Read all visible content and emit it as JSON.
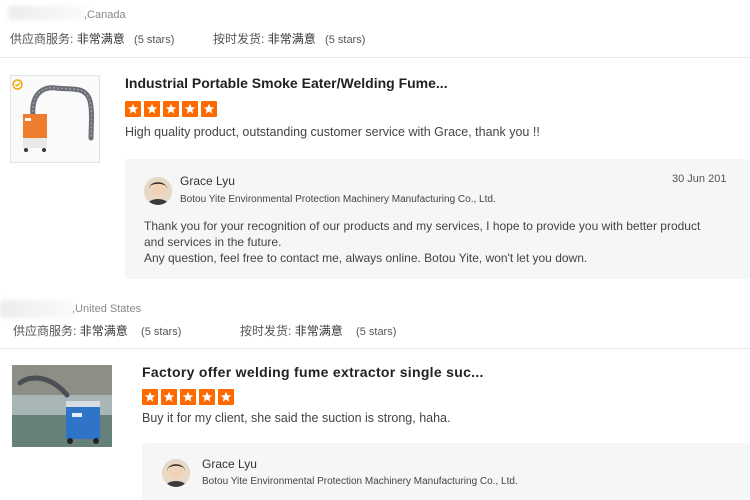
{
  "reviews": [
    {
      "country": ",Canada",
      "supplier_service_label": "供应商服务:",
      "supplier_service_value": "非常满意",
      "supplier_service_stars": "(5 stars)",
      "on_time_label": "按时发货:",
      "on_time_value": "非常满意",
      "on_time_stars": "(5 stars)",
      "product_title": "Industrial Portable Smoke Eater/Welding Fume...",
      "rating": 5,
      "review_text": "High quality product, outstanding customer service with Grace, thank you !!",
      "reply": {
        "name": "Grace Lyu",
        "company": "Botou Yite Environmental Protection Machinery Manufacturing Co., Ltd.",
        "date": "30 Jun 201",
        "text_line1": "Thank you for your recognition of our products and my services, I hope to provide you with better product",
        "text_line2": "and services in the future.",
        "text_line3": "Any question, feel free to contact me, always online. Botou Yite, won't let you down."
      }
    },
    {
      "country": ",United States",
      "supplier_service_label": "供应商服务:",
      "supplier_service_value": "非常满意",
      "supplier_service_stars": "(5 stars)",
      "on_time_label": "按时发货:",
      "on_time_value": "非常满意",
      "on_time_stars": "(5 stars)",
      "product_title": "Factory offer welding fume extractor single suc...",
      "rating": 5,
      "review_text": "Buy it for my client, she said the suction is strong, haha.",
      "reply": {
        "name": "Grace Lyu",
        "company": "Botou Yite Environmental Protection Machinery Manufacturing Co., Ltd."
      }
    }
  ],
  "colors": {
    "star": "#ff6a00",
    "reply_bg": "#f5f6f8",
    "divider": "#e8e8e8"
  },
  "icons": {
    "star": "star-icon",
    "badge": "gold-supplier-badge-icon"
  }
}
